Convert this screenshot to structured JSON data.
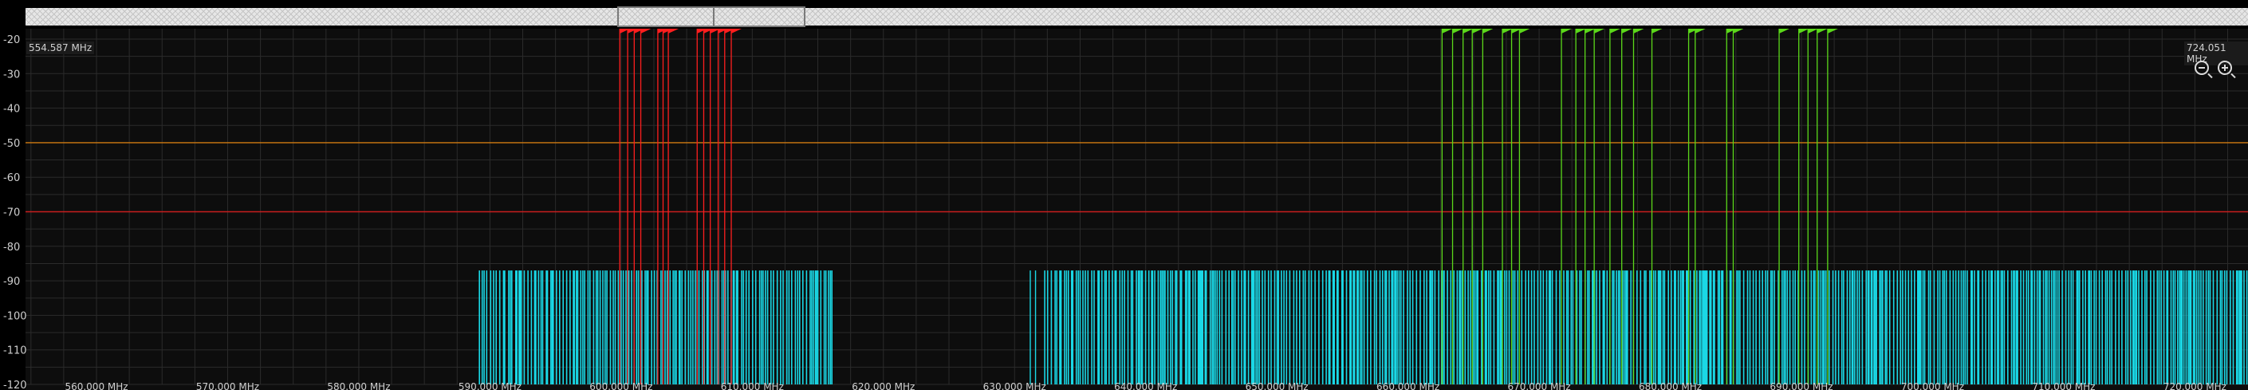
{
  "spectrum": {
    "start_readout": "554.587 MHz",
    "end_readout": "724.051 MHz"
  },
  "icons": [
    "zoom-out-icon",
    "zoom-in-icon"
  ],
  "colors": {
    "background": "#0d0d0d",
    "grid": "#2b2b2b",
    "trace": "#1ad8e6",
    "threshold_orange": "#d07a10",
    "threshold_red": "#c81e1e",
    "marker_red": "#ff1e1e",
    "marker_green": "#5bd81a"
  },
  "chart_data": {
    "type": "bar",
    "title": "",
    "xlabel": "",
    "ylabel": "",
    "xlim": [
      554.587,
      724.051
    ],
    "ylim": [
      -120,
      -17
    ],
    "grid": true,
    "x_tick_labels": [
      "560.000 MHz",
      "570.000 MHz",
      "580.000 MHz",
      "590.000 MHz",
      "600.000 MHz",
      "610.000 MHz",
      "620.000 MHz",
      "630.000 MHz",
      "640.000 MHz",
      "650.000 MHz",
      "660.000 MHz",
      "670.000 MHz",
      "680.000 MHz",
      "690.000 MHz",
      "700.000 MHz",
      "710.000 MHz",
      "720.000 MHz"
    ],
    "x_ticks": [
      560,
      570,
      580,
      590,
      600,
      610,
      620,
      630,
      640,
      650,
      660,
      670,
      680,
      690,
      700,
      710,
      720
    ],
    "y_ticks": [
      -20,
      -30,
      -40,
      -50,
      -60,
      -70,
      -80,
      -90,
      -100,
      -110,
      -120
    ],
    "y_tick_labels": [
      "-20",
      "-30",
      "-40",
      "-50",
      "-60",
      "-70",
      "-80",
      "-90",
      "-100",
      "-110",
      "-120"
    ],
    "thresholds": [
      {
        "level": -50,
        "color": "#d07a10"
      },
      {
        "level": -70,
        "color": "#c81e1e"
      }
    ],
    "noise_floor": -87,
    "occupied_ranges_mhz": [
      [
        589.2,
        616.1
      ],
      [
        632.3,
        724.05
      ]
    ],
    "red_markers_mhz": [
      599.9,
      600.5,
      601.0,
      601.5,
      602.8,
      603.2,
      603.6,
      605.8,
      606.3,
      606.8,
      607.4,
      607.9,
      608.4
    ],
    "green_markers_mhz": [
      662.6,
      663.4,
      664.2,
      664.9,
      665.7,
      667.2,
      667.9,
      668.5,
      671.7,
      672.8,
      673.5,
      674.2,
      675.4,
      676.3,
      677.2,
      678.6,
      681.4,
      681.9,
      684.3,
      684.8,
      688.3,
      689.8,
      690.5,
      691.2,
      692.0
    ]
  }
}
